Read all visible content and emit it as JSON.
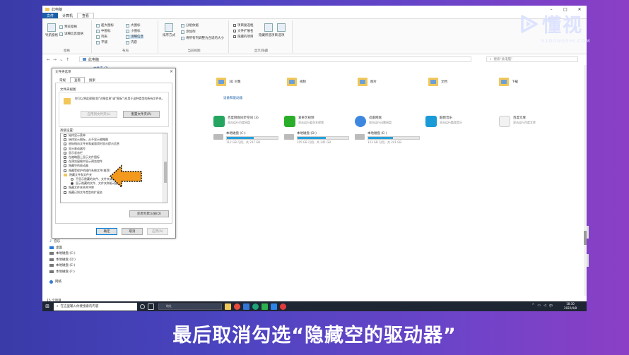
{
  "window": {
    "title": "此电脑",
    "tabs": [
      "文件",
      "计算机",
      "查看"
    ],
    "active_tab_index": 2
  },
  "ribbon": {
    "groups": [
      "窗格",
      "布局",
      "当前视图",
      "显示/隐藏"
    ],
    "pane": {
      "nav_pane": "导航窗格",
      "preview": "预览窗格",
      "details": "详细信息窗格"
    },
    "layout": {
      "items": [
        "超大图标",
        "大图标",
        "中图标",
        "小图标",
        "列表",
        "详细信息",
        "平铺",
        "内容"
      ]
    },
    "current_view": {
      "sort": "排序方式",
      "group": "分组依据",
      "add_columns": "添加列",
      "fit_columns": "将所有列调整为合适的大小"
    },
    "show_hide": {
      "checkboxes": "项目复选框",
      "ext": "文件扩展名",
      "hidden": "隐藏的项目",
      "hide_selected": "隐藏所选项目",
      "options": "选项"
    }
  },
  "address": {
    "path": "此电脑",
    "search_placeholder": "搜索\"此电脑\""
  },
  "content": {
    "section_folders": "文件夹 (7)",
    "folders": [
      {
        "label": "3D 对象"
      },
      {
        "label": "视频"
      },
      {
        "label": "图片"
      },
      {
        "label": "文档"
      },
      {
        "label": "下载"
      }
    ],
    "section_apps": "设备和驱动器",
    "apps": [
      {
        "name": "百度网盘同步空间 (3)",
        "sub": "双击运行百度网盘"
      },
      {
        "name": "WPS网盘",
        "sub": "双击进入WPS网盘"
      },
      {
        "name": "爱奇艺视频",
        "sub": "双击运行爱奇艺视频"
      },
      {
        "name": "迅雷网盘",
        "sub": "双击运行迅雷网盘"
      },
      {
        "name": "酷我音乐",
        "sub": "双击运行酷我音乐"
      },
      {
        "name": "百度文库",
        "sub": "双击运行百度文库"
      }
    ],
    "drives": [
      {
        "name": "本地磁盘 (C:)",
        "free": "112 GB 可用，共 237 GB",
        "used": 0.53
      },
      {
        "name": "本地磁盘 (D:)",
        "free": "105 GB 可用，共 241 GB",
        "used": 0.56
      },
      {
        "name": "本地磁盘 (E:)",
        "free": "123 GB 可用，共 241 GB",
        "used": 0.49
      },
      {
        "name": "本地磁盘 (F:)",
        "free": "232 GB 可用，共 245 GB",
        "used": 0.05
      }
    ]
  },
  "nav": {
    "items": [
      "音乐",
      "桌面",
      "本地磁盘 (C:)",
      "本地磁盘 (D:)",
      "本地磁盘 (E:)",
      "本地磁盘 (F:)",
      "网络"
    ],
    "status": "15 个项目"
  },
  "dialog": {
    "title": "文件夹选项",
    "close": "×",
    "tabs": [
      "常规",
      "查看",
      "搜索"
    ],
    "active_tab_index": 1,
    "folder_views_label": "文件夹视图",
    "folder_views_desc": "你可以将此视图(如\"详细信息\"或\"图标\")应用于这种类型的所有文件夹。",
    "apply_to_folders": "应用到文件夹(L)",
    "reset_folders": "重置文件夹(R)",
    "advanced_label": "高级设置:",
    "advanced_items": [
      {
        "text": "始终显示菜单",
        "checked": false,
        "kind": "cb"
      },
      {
        "text": "始终显示图标，从不显示缩略图",
        "checked": false,
        "kind": "cb"
      },
      {
        "text": "鼠标指向文件夹和桌面项时显示提示信息",
        "checked": true,
        "kind": "cb"
      },
      {
        "text": "显示驱动器号",
        "checked": true,
        "kind": "cb"
      },
      {
        "text": "显示状态栏",
        "checked": true,
        "kind": "cb"
      },
      {
        "text": "在缩略图上显示文件图标",
        "checked": true,
        "kind": "cb"
      },
      {
        "text": "在预览窗格中显示预览控件",
        "checked": true,
        "kind": "cb"
      },
      {
        "text": "隐藏空的驱动器",
        "checked": true,
        "kind": "cb"
      },
      {
        "text": "隐藏受保护的操作系统文件(推荐)",
        "checked": true,
        "kind": "cb"
      },
      {
        "text": "隐藏文件和文件夹",
        "checked": false,
        "kind": "folder"
      },
      {
        "text": "不显示隐藏的文件、文件夹或驱动器",
        "checked": false,
        "kind": "rb"
      },
      {
        "text": "显示隐藏的文件、文件夹和驱动器",
        "checked": true,
        "kind": "rb"
      },
      {
        "text": "隐藏文件夹合并冲突",
        "checked": true,
        "kind": "cb"
      },
      {
        "text": "隐藏已知文件类型的扩展名",
        "checked": true,
        "kind": "cb"
      }
    ],
    "restore_defaults": "还原为默认值(D)",
    "ok": "确定",
    "cancel": "取消",
    "apply": "应用(A)"
  },
  "taskbar": {
    "search_placeholder": "在这里输入你要搜索的内容",
    "address_placeholder": "地址",
    "time": "18:30",
    "date": "2022/4/8",
    "ime": "中"
  },
  "logo": {
    "cn": "懂视",
    "en": "51DONGSHI.COM"
  },
  "caption": "最后取消勾选“隐藏空的驱动器”",
  "colors": {
    "accent": "#1a5ea8",
    "drive_bar": "#26a0da",
    "arrow": "#f39a1e"
  }
}
